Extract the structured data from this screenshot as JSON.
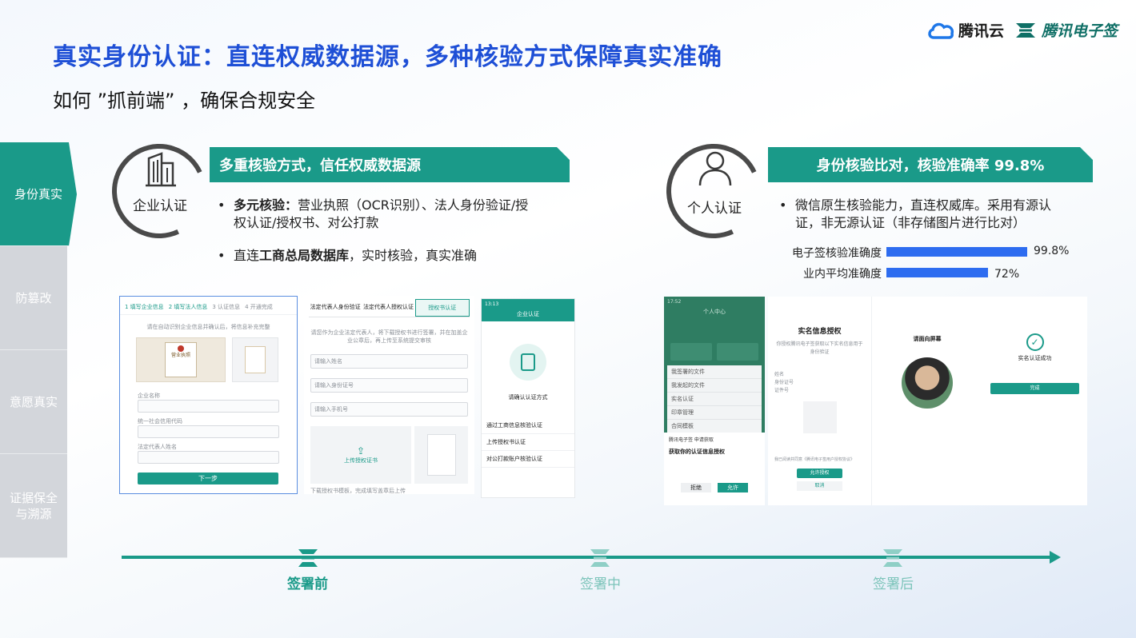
{
  "header": {
    "title": "真实身份认证：直连权威数据源，多种核验方式保障真实准确",
    "subtitle": "如何 ”抓前端” ，确保合规安全",
    "logo_cloud": "腾讯云",
    "logo_esign": "腾讯电子签"
  },
  "side_nav": [
    {
      "label": "身份真实",
      "active": true
    },
    {
      "label": "防篡改",
      "active": false
    },
    {
      "label": "意愿真实",
      "active": false
    },
    {
      "label": "证据保全\n与溯源",
      "active": false
    }
  ],
  "enterprise": {
    "circle_label": "企业认证",
    "banner": "多重核验方式，信任权威数据源",
    "bullet1_bold": "多元核验：",
    "bullet1_line1": "营业执照（OCR识别）、法人身份验证/授",
    "bullet1_line2": "权认证/授权书、对公打款",
    "bullet2_pre": "直连",
    "bullet2_bold": "工商总局数据库",
    "bullet2_post": "，实时核验，真实准确"
  },
  "personal": {
    "circle_label": "个人认证",
    "banner": "身份核验比对，核验准确率 99.8%",
    "bullet1_line1": "微信原生核验能力，直连权威库。采用有源认",
    "bullet1_line2": "证，非无源认证（非存储图片进行比对）"
  },
  "chart_data": {
    "type": "bar",
    "categories": [
      "电子签核验准确度",
      "业内平均准确度"
    ],
    "values": [
      99.8,
      72
    ],
    "value_labels": [
      "99.8%",
      "72%"
    ],
    "xlim": [
      0,
      100
    ],
    "color": "#2d6cf0"
  },
  "shots": {
    "s1": {
      "steps": [
        "1 填写企业信息",
        "2 填写法人信息",
        "3 认证信息",
        "4 开通完成"
      ],
      "hint": "请在自动识别企业信息并确认后，将信息补充完整",
      "license_title": "营业执照",
      "field1": "企业名称",
      "field2": "统一社会信用代码",
      "field3": "法定代表人姓名",
      "next": "下一步"
    },
    "s2": {
      "tabs": [
        "法定代表人身份验证",
        "法定代表人授权认证",
        "授权书认证"
      ],
      "desc": "请您作为企业法定代表人，将下载授权书进行签署，并在加盖企业公章后，再上传至系统提交审核",
      "placeholders": [
        "请输入姓名",
        "请输入身份证号",
        "请输入手机号"
      ],
      "upload": "上传授权证书",
      "footer": "下载授权书模板，完成填写盖章后上传"
    },
    "s3": {
      "time": "13:13",
      "nav_title": "企业认证",
      "heading": "请确认认证方式",
      "options": [
        "通过工商信息核验认证",
        "上传授权书认证",
        "对公打款账户核验认证"
      ]
    },
    "s4": {
      "time": "17:52",
      "nav_title": "个人中心",
      "items": [
        "我签署的文件",
        "我发起的文件",
        "实名认证",
        "印章管理",
        "合同模板"
      ],
      "popup_title": "腾讯电子签 申请获取",
      "popup_body": "获取你的认证信息授权",
      "deny": "拒绝",
      "allow": "允许"
    },
    "s5": {
      "title": "实名信息授权",
      "desc": "你授权腾讯电子签获取以下实名信息用于身份验证",
      "rows": [
        "姓名",
        "身份证号",
        "证件号"
      ],
      "agree": "我已阅读并同意《腾讯电子签用户授权协议》",
      "allow_btn": "允许授权",
      "cancel_btn": "取消",
      "face_title": "请面向屏幕",
      "success": "实名认证成功",
      "done": "完成"
    }
  },
  "timeline": [
    {
      "label": "签署前",
      "active": true
    },
    {
      "label": "签署中",
      "active": false
    },
    {
      "label": "签署后",
      "active": false
    }
  ]
}
